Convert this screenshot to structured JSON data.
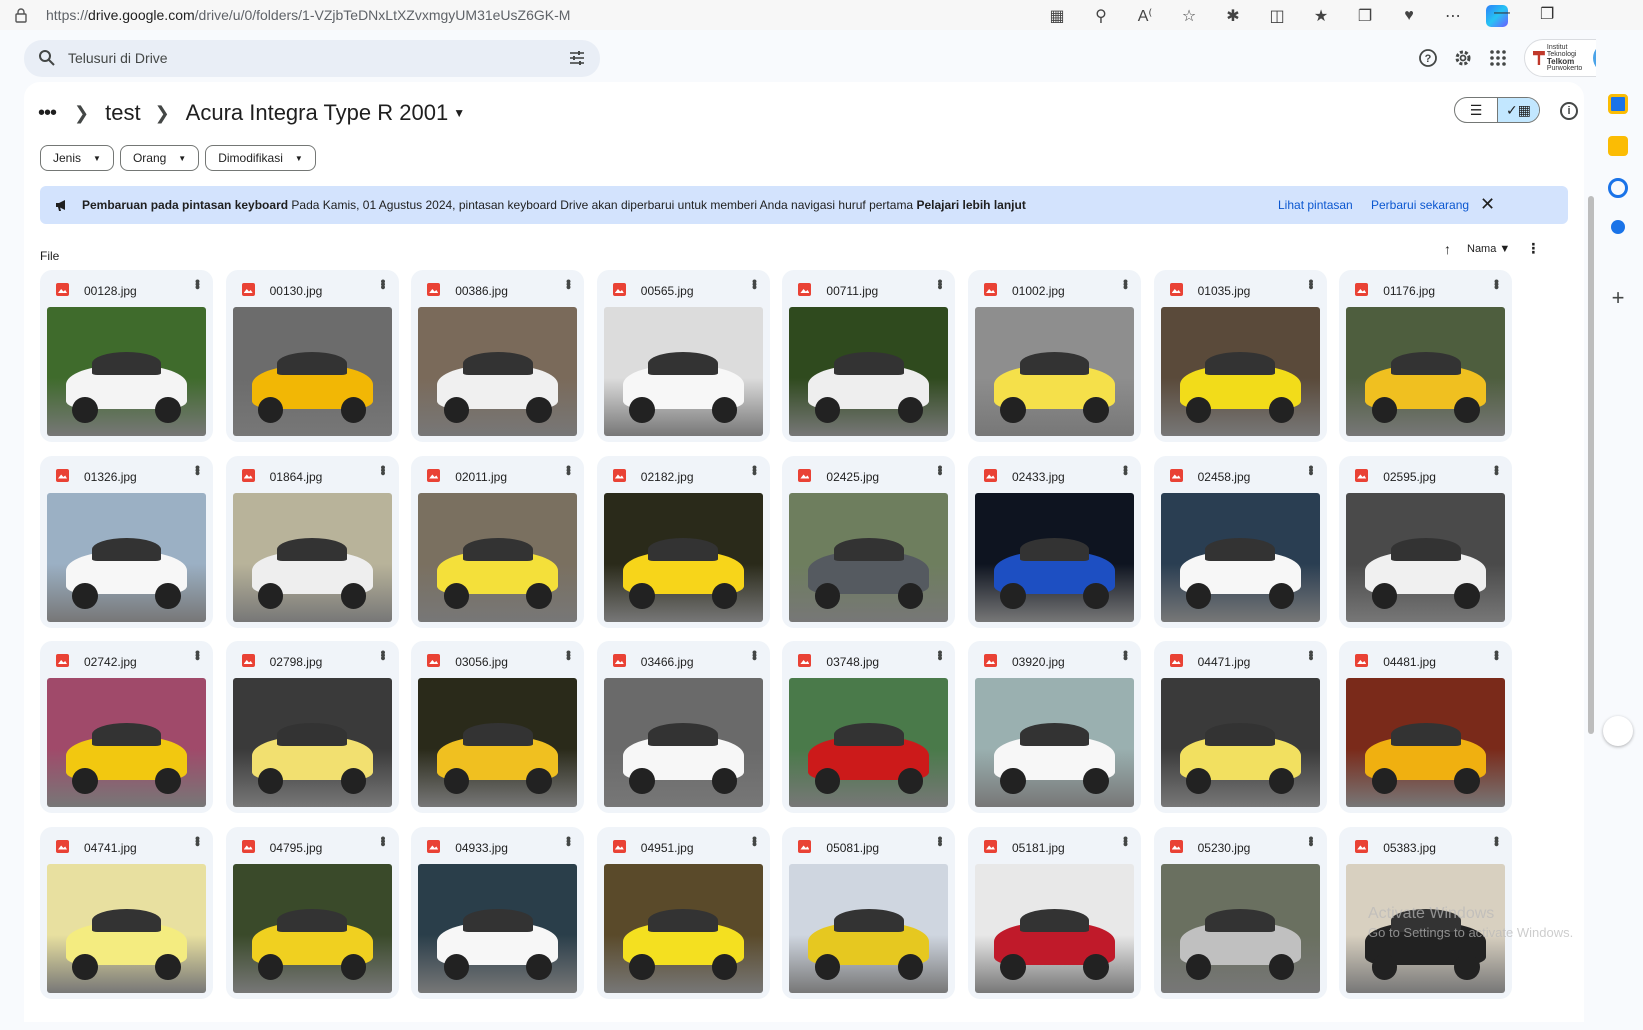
{
  "browser": {
    "url_prefix": "https://",
    "url_host": "drive.google.com",
    "url_path": "/drive/u/0/folders/1-VZjbTeDNxLtXZvxmgyUM31eUsZ6GK-M"
  },
  "search": {
    "placeholder": "Telusuri di Drive"
  },
  "profile": {
    "org_line1": "Institut Teknologi",
    "org_line2": "Telkom",
    "org_line3": "Purwokerto"
  },
  "breadcrumb": {
    "parent": "test",
    "current": "Acura Integra Type R 2001"
  },
  "filters": [
    "Jenis",
    "Orang",
    "Dimodifikasi"
  ],
  "banner": {
    "title": "Pembaruan pada pintasan keyboard",
    "message": "Pada Kamis, 01 Agustus 2024, pintasan keyboard Drive akan diperbarui untuk memberi Anda navigasi huruf pertama",
    "learn_more": "Pelajari lebih lanjut",
    "view_shortcuts": "Lihat pintasan",
    "update_now": "Perbarui sekarang"
  },
  "section_label": "File",
  "sort": {
    "label": "Nama"
  },
  "files": [
    {
      "name": "00128.jpg",
      "bg": "#3f6b2c",
      "car": "#f4f4f4"
    },
    {
      "name": "00130.jpg",
      "bg": "#6c6c6c",
      "car": "#f2b705"
    },
    {
      "name": "00386.jpg",
      "bg": "#7a6a5a",
      "car": "#f0f0f0"
    },
    {
      "name": "00565.jpg",
      "bg": "#dcdcdc",
      "car": "#f7f7f7"
    },
    {
      "name": "00711.jpg",
      "bg": "#2f4a1e",
      "car": "#eeeeee"
    },
    {
      "name": "01002.jpg",
      "bg": "#8e8e8e",
      "car": "#f5e04a"
    },
    {
      "name": "01035.jpg",
      "bg": "#5a4a3a",
      "car": "#f2dc1a"
    },
    {
      "name": "01176.jpg",
      "bg": "#4e5e3e",
      "car": "#f0c020"
    },
    {
      "name": "01326.jpg",
      "bg": "#9bb0c4",
      "car": "#f7f7f7"
    },
    {
      "name": "01864.jpg",
      "bg": "#b8b39a",
      "car": "#eeeeee"
    },
    {
      "name": "02011.jpg",
      "bg": "#7a7060",
      "car": "#f4e03a"
    },
    {
      "name": "02182.jpg",
      "bg": "#2a2a1a",
      "car": "#f7d51a"
    },
    {
      "name": "02425.jpg",
      "bg": "#6e7e5e",
      "car": "#555a60"
    },
    {
      "name": "02433.jpg",
      "bg": "#0e1420",
      "car": "#1d4fc2"
    },
    {
      "name": "02458.jpg",
      "bg": "#2a3e52",
      "car": "#f7f7f7"
    },
    {
      "name": "02595.jpg",
      "bg": "#4a4a4a",
      "car": "#f0f0f0"
    },
    {
      "name": "02742.jpg",
      "bg": "#a04a6a",
      "car": "#f2c810"
    },
    {
      "name": "02798.jpg",
      "bg": "#3a3a3a",
      "car": "#f2e070"
    },
    {
      "name": "03056.jpg",
      "bg": "#2a2a1a",
      "car": "#f0c020"
    },
    {
      "name": "03466.jpg",
      "bg": "#6a6a6a",
      "car": "#f7f7f7"
    },
    {
      "name": "03748.jpg",
      "bg": "#4a7a4a",
      "car": "#cc1a1a"
    },
    {
      "name": "03920.jpg",
      "bg": "#9ab0b0",
      "car": "#f7f7f7"
    },
    {
      "name": "04471.jpg",
      "bg": "#3a3a3a",
      "car": "#f2e060"
    },
    {
      "name": "04481.jpg",
      "bg": "#7a2a1a",
      "car": "#f0b010"
    },
    {
      "name": "04741.jpg",
      "bg": "#e8e0a0",
      "car": "#f4ec80"
    },
    {
      "name": "04795.jpg",
      "bg": "#3a4a2a",
      "car": "#f0d020"
    },
    {
      "name": "04933.jpg",
      "bg": "#2a3e4a",
      "car": "#f7f7f7"
    },
    {
      "name": "04951.jpg",
      "bg": "#5a4a2a",
      "car": "#f4e020"
    },
    {
      "name": "05081.jpg",
      "bg": "#cfd6e0",
      "car": "#e6c820"
    },
    {
      "name": "05181.jpg",
      "bg": "#e8e8e8",
      "car": "#c01a2a"
    },
    {
      "name": "05230.jpg",
      "bg": "#6a7060",
      "car": "#c0c0c0"
    },
    {
      "name": "05383.jpg",
      "bg": "#d8d0c0",
      "car": "#222222"
    }
  ],
  "watermark": {
    "line1": "Activate Windows",
    "line2": "Go to Settings to activate Windows."
  }
}
